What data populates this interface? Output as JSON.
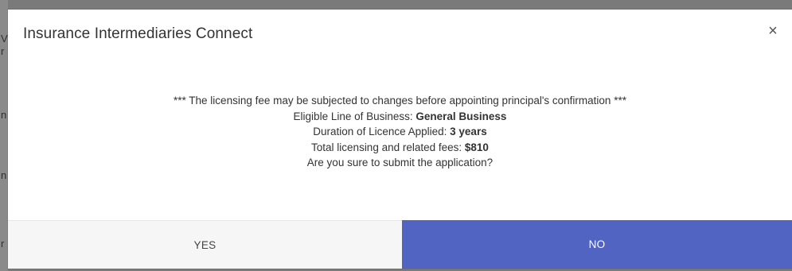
{
  "background": {
    "glyphs": [
      "r",
      "V",
      "n",
      "n",
      "r"
    ]
  },
  "dialog": {
    "title": "Insurance Intermediaries Connect",
    "close_glyph": "×",
    "message": {
      "warning": "*** The licensing fee may be subjected to changes before appointing principal's confirmation ***",
      "line_of_business_label": "Eligible Line of Business: ",
      "line_of_business_value": "General Business",
      "duration_label": "Duration of Licence Applied: ",
      "duration_value": "3 years",
      "fees_label": "Total licensing and related fees: ",
      "fees_value": "$810",
      "question": "Are you sure to submit the application?"
    },
    "yes_label": "YES",
    "no_label": "NO"
  },
  "colors": {
    "primary": "#5264c2",
    "overlay": "#7a7a7a",
    "secondary_button": "#f6f6f6"
  }
}
